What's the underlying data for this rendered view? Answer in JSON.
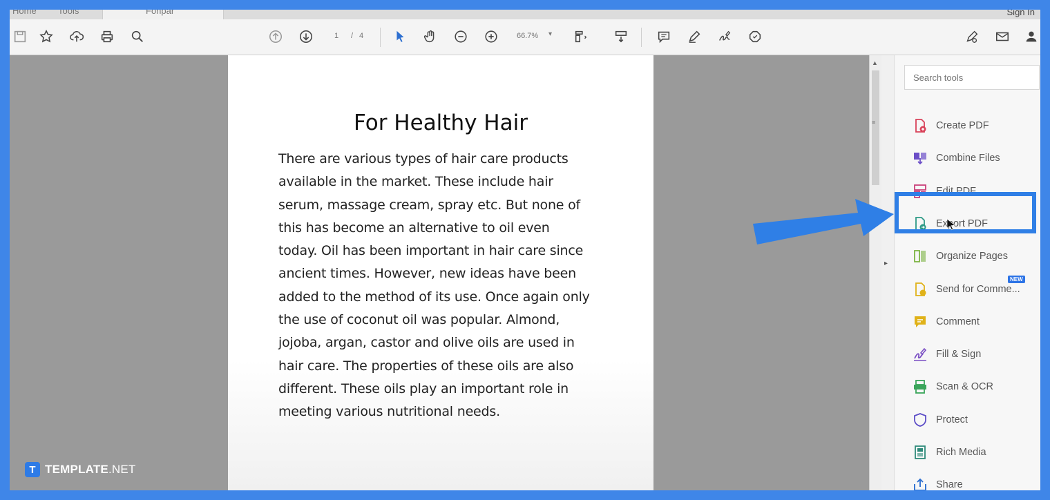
{
  "tabs": {
    "home": "Home",
    "tools": "Tools",
    "document": "Fonpar",
    "sign_in": "Sign In"
  },
  "toolbar": {
    "page_current": "1",
    "page_separator": "/",
    "page_total": "4",
    "zoom": "66.7%",
    "icons": [
      "save-icon",
      "star-icon",
      "upload-icon",
      "print-icon",
      "zoom-search-icon",
      "prev-page-icon",
      "next-page-icon",
      "select-pointer-icon",
      "hand-icon",
      "zoom-out-icon",
      "zoom-in-icon",
      "fit-page-icon",
      "scroll-mode-icon",
      "comment-icon",
      "pen-icon",
      "sign-icon",
      "stamp-icon",
      "share-link-icon",
      "mail-icon",
      "user-icon"
    ]
  },
  "document": {
    "title": "For Healthy Hair",
    "lines": [
      "There are various types of hair care products",
      "available in the market. These include hair",
      "serum, massage cream, spray etc. But none of",
      "this has become an alternative to oil even",
      "today. Oil has been important in hair care since",
      "ancient times. However, new ideas have been",
      "added to the method of its use. Once again only",
      "the use of coconut oil was popular. Almond,",
      "jojoba, argan, castor and olive oils are used in",
      "hair care. The properties of these oils are also",
      "different. These oils play an important role in",
      "meeting various nutritional needs."
    ]
  },
  "tools_pane": {
    "search_placeholder": "Search tools",
    "items": [
      {
        "label": "Create PDF",
        "icon": "create-pdf-icon",
        "color": "#d9435a"
      },
      {
        "label": "Combine Files",
        "icon": "combine-files-icon",
        "color": "#6b4ec7"
      },
      {
        "label": "Edit PDF",
        "icon": "edit-pdf-icon",
        "color": "#c9407a"
      },
      {
        "label": "Export PDF",
        "icon": "export-pdf-icon",
        "color": "#2e9a86"
      },
      {
        "label": "Organize Pages",
        "icon": "organize-pages-icon",
        "color": "#7cb342"
      },
      {
        "label": "Send for Comme...",
        "icon": "send-comment-icon",
        "color": "#e0b219",
        "badge": "NEW"
      },
      {
        "label": "Comment",
        "icon": "comment-tool-icon",
        "color": "#e0b219"
      },
      {
        "label": "Fill & Sign",
        "icon": "fill-sign-icon",
        "color": "#7a4fc4"
      },
      {
        "label": "Scan & OCR",
        "icon": "scan-ocr-icon",
        "color": "#3aa55a"
      },
      {
        "label": "Protect",
        "icon": "protect-icon",
        "color": "#5d4ec7"
      },
      {
        "label": "Rich Media",
        "icon": "rich-media-icon",
        "color": "#2e8a7a"
      },
      {
        "label": "Share",
        "icon": "share-icon",
        "color": "#2d6fd0"
      }
    ]
  },
  "annotation": {
    "highlight_color": "#2f7fe6",
    "highlighted_tool": "Export PDF"
  },
  "watermark": {
    "mark": "T",
    "brand_bold": "TEMPLATE",
    "brand_suffix": ".NET"
  }
}
